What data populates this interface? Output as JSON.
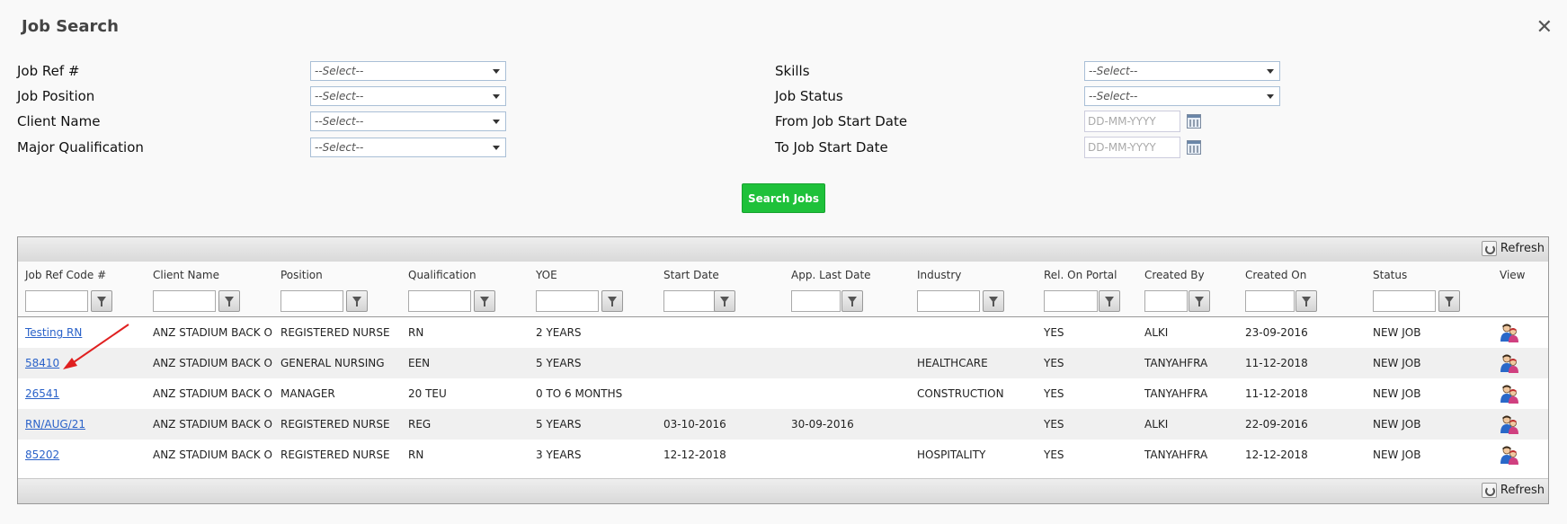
{
  "dialog": {
    "title": "Job Search",
    "close_symbol": "✕"
  },
  "form": {
    "left": [
      {
        "label": "Job Ref #",
        "value": "--Select--"
      },
      {
        "label": "Job Position",
        "value": "--Select--"
      },
      {
        "label": "Client Name",
        "value": "--Select--"
      },
      {
        "label": "Major Qualification",
        "value": "--Select--"
      }
    ],
    "right": [
      {
        "label": "Skills",
        "value": "--Select--"
      },
      {
        "label": "Job Status",
        "value": "--Select--"
      },
      {
        "label": "From Job Start Date",
        "placeholder": "DD-MM-YYYY"
      },
      {
        "label": "To Job Start Date",
        "placeholder": "DD-MM-YYYY"
      }
    ],
    "search_button": "Search Jobs"
  },
  "grid": {
    "refresh_label": "Refresh",
    "columns": [
      "Job Ref Code #",
      "Client Name",
      "Position",
      "Qualification",
      "YOE",
      "Start Date",
      "App. Last Date",
      "Industry",
      "Rel. On Portal",
      "Created By",
      "Created On",
      "Status",
      "View"
    ],
    "rows": [
      [
        "Testing RN",
        "ANZ STADIUM BACK O",
        "REGISTERED NURSE",
        "RN",
        "2 YEARS",
        "",
        "",
        "",
        "YES",
        "ALKI",
        "23-09-2016",
        "NEW JOB"
      ],
      [
        "58410",
        "ANZ STADIUM BACK O",
        "GENERAL NURSING",
        "EEN",
        "5 YEARS",
        "",
        "",
        "HEALTHCARE",
        "YES",
        "TANYAHFRA",
        "11-12-2018",
        "NEW JOB"
      ],
      [
        "26541",
        "ANZ STADIUM BACK O",
        "MANAGER",
        "20 TEU",
        "0 TO 6 MONTHS",
        "",
        "",
        "CONSTRUCTION",
        "YES",
        "TANYAHFRA",
        "11-12-2018",
        "NEW JOB"
      ],
      [
        "RN/AUG/21",
        "ANZ STADIUM BACK O",
        "REGISTERED NURSE",
        "REG",
        "5 YEARS",
        "03-10-2016",
        "30-09-2016",
        "",
        "YES",
        "ALKI",
        "22-09-2016",
        "NEW JOB"
      ],
      [
        "85202",
        "ANZ STADIUM BACK O",
        "REGISTERED NURSE",
        "RN",
        "3 YEARS",
        "12-12-2018",
        "",
        "HOSPITALITY",
        "YES",
        "TANYAHFRA",
        "12-12-2018",
        "NEW JOB"
      ]
    ]
  },
  "icons": {
    "close": "close-icon",
    "dropdown": "chevron-down-icon",
    "calendar": "calendar-icon",
    "filter": "filter-icon",
    "refresh": "refresh-icon",
    "view": "users-icon"
  },
  "colors": {
    "search_button": "#1ec13a",
    "link": "#2a62c9",
    "annotation_arrow": "#e02020"
  }
}
